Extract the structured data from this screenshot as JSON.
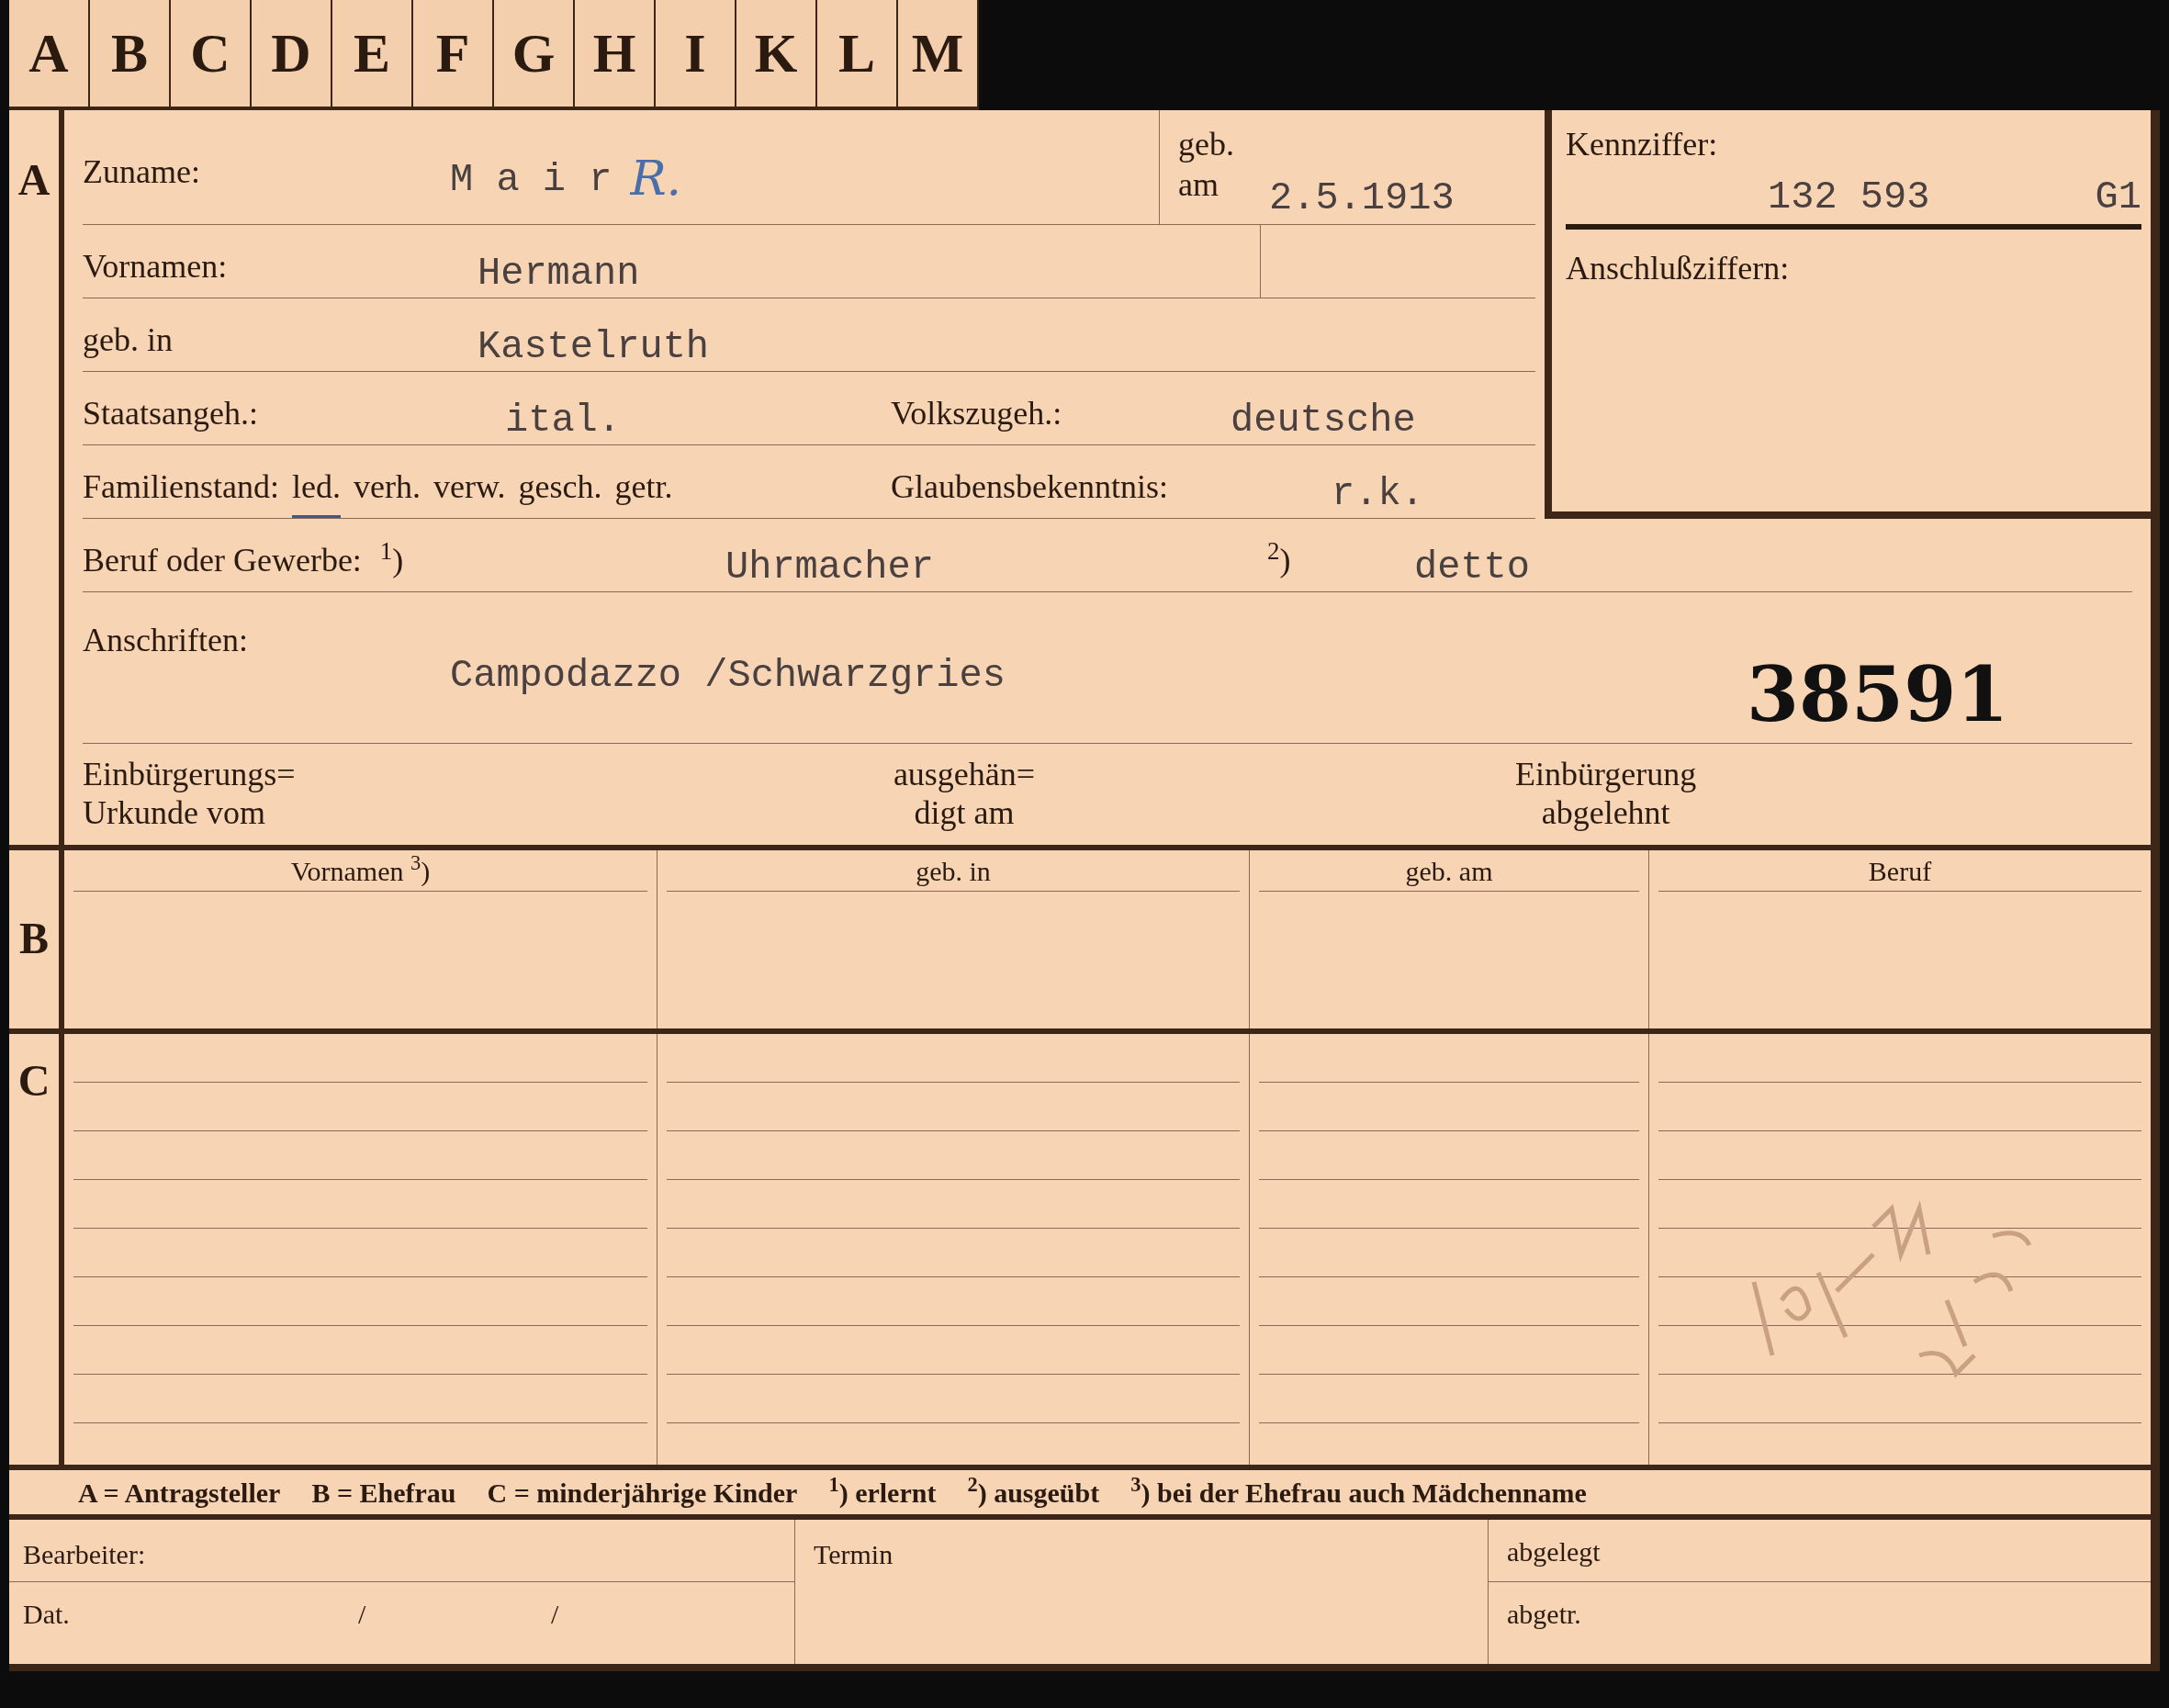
{
  "index_tabs": [
    "A",
    "B",
    "C",
    "D",
    "E",
    "F",
    "G",
    "H",
    "I",
    "K",
    "L",
    "M"
  ],
  "section_a": {
    "letter": "A",
    "surname": {
      "label": "Zuname:",
      "value": "M a i r",
      "handwritten": "R."
    },
    "birth_date": {
      "label_1": "geb.",
      "label_2": "am",
      "value": "2.5.1913"
    },
    "given_names": {
      "label": "Vornamen:",
      "value": "Hermann"
    },
    "birthplace": {
      "label": "geb. in",
      "value": "Kastelruth"
    },
    "citizenship": {
      "label": "Staatsangeh.:",
      "value": "ital."
    },
    "ethnicity": {
      "label": "Volkszugeh.:",
      "value": "deutsche"
    },
    "marital_status": {
      "label": "Familienstand:",
      "options": [
        {
          "label": "led.",
          "selected": true
        },
        {
          "label": "verh.",
          "selected": false
        },
        {
          "label": "verw.",
          "selected": false
        },
        {
          "label": "gesch.",
          "selected": false
        },
        {
          "label": "getr.",
          "selected": false
        }
      ]
    },
    "religion": {
      "label": "Glaubensbekenntnis:",
      "value": "r.k."
    },
    "reference": {
      "label": "Kennziffer:",
      "number": "132 593",
      "suffix": "G1"
    },
    "connection_numbers": {
      "label": "Anschlußziffern:"
    },
    "occupation": {
      "label": "Beruf oder Gewerbe:",
      "mark_1": "$^{1}$)",
      "value_1": "Uhrmacher",
      "mark_2": "$^{2}$)",
      "value_2": "detto"
    },
    "addresses": {
      "label": "Anschriften:",
      "value": "Campodazzo /Schwarzgries"
    },
    "stamp_number": "38591",
    "certificate": "Einbürgerungs=\nUrkunde vom",
    "handed_out": "ausgehän=\ndigt am",
    "refused": "Einbürgerung\nabgelehnt"
  },
  "section_b": {
    "letter": "B",
    "columns": [
      "Vornamen $^{3}$)",
      "geb. in",
      "geb. am",
      "Beruf"
    ]
  },
  "section_c": {
    "letter": "C"
  },
  "legend": [
    "A = Antragsteller",
    "B = Ehefrau",
    "C = minderjährige Kinder",
    "$^{1}$) erlernt",
    "$^{2}$) ausgeübt",
    "$^{3}$) bei der Ehefrau auch **Mädchenname**"
  ],
  "footer": {
    "clerk": "Bearbeiter:",
    "date": "Dat.",
    "separators": [
      "/",
      "/"
    ],
    "deadline": "Termin",
    "filed": "abgelegt",
    "removed": "abgetr."
  }
}
